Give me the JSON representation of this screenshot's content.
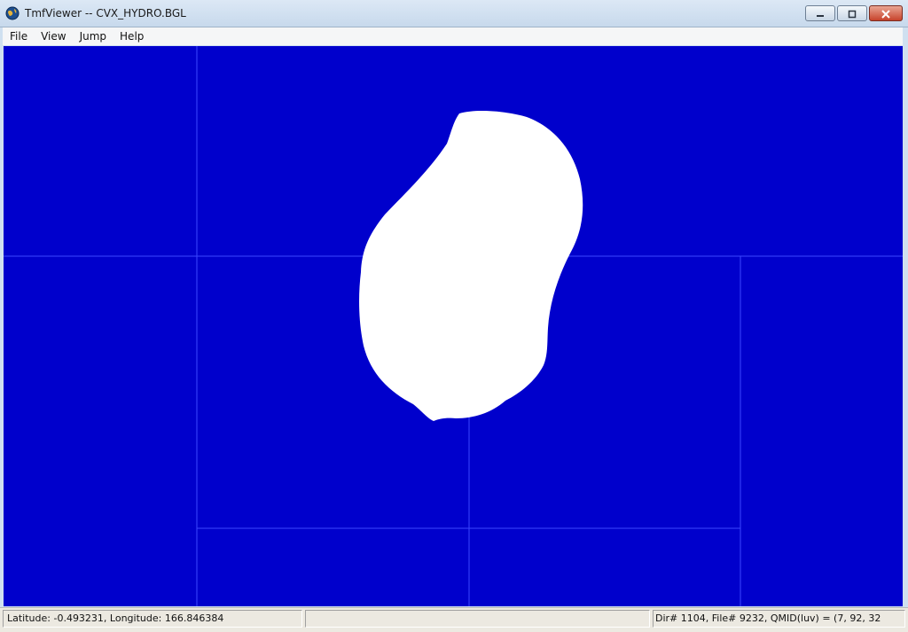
{
  "window": {
    "title": "TmfViewer -- CVX_HYDRO.BGL",
    "controls": {
      "minimize_icon": "minimize-icon",
      "maximize_icon": "maximize-icon",
      "close_icon": "close-icon"
    }
  },
  "menubar": {
    "items": [
      {
        "label": "File"
      },
      {
        "label": "View"
      },
      {
        "label": "Jump"
      },
      {
        "label": "Help"
      }
    ]
  },
  "map": {
    "background_color": "#0000cc",
    "grid_color": "#3b47ff",
    "land_color": "#ffffff"
  },
  "statusbar": {
    "coordinates": "Latitude: -0.493231, Longitude: 166.846384",
    "middle": "",
    "tile_info": "Dir# 1104, File# 9232, QMID(luv) = (7, 92, 32"
  }
}
